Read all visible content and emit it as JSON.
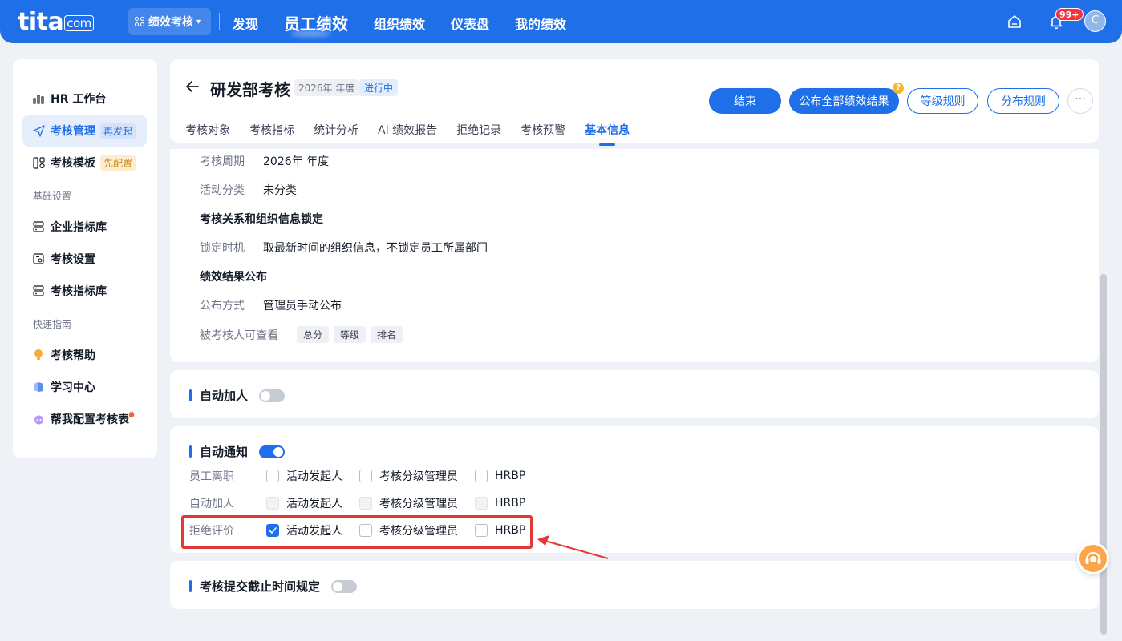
{
  "topbar": {
    "logo": "tita",
    "logo_suffix": "com",
    "module_switch": "绩效考核",
    "nav": [
      "发现",
      "员工绩效",
      "组织绩效",
      "仪表盘",
      "我的绩效"
    ],
    "notification_count": "99+",
    "avatar_initial": "C"
  },
  "sidebar": {
    "hr_workbench": "HR 工作台",
    "assessment_mgmt": "考核管理",
    "assessment_mgmt_tag": "再发起",
    "assessment_template": "考核模板",
    "assessment_template_tag": "先配置",
    "group_basic": "基础设置",
    "enterprise_indicators": "企业指标库",
    "assessment_settings": "考核设置",
    "assessment_indicators": "考核指标库",
    "group_guide": "快速指南",
    "assessment_help": "考核帮助",
    "learning_center": "学习中心",
    "config_helper": "帮我配置考核表"
  },
  "header": {
    "title": "研发部考核",
    "period_tag": "2026年 年度",
    "status_tag": "进行中",
    "btn_end": "结束",
    "btn_publish": "公布全部绩效结果",
    "btn_publish_hint": "?",
    "btn_grade_rules": "等级规则",
    "btn_dist_rules": "分布规则",
    "btn_more": "···",
    "tabs": [
      "考核对象",
      "考核指标",
      "统计分析",
      "AI 绩效报告",
      "拒绝记录",
      "考核预警",
      "基本信息"
    ],
    "active_tab": "基本信息"
  },
  "info": {
    "period_label": "考核周期",
    "period_value": "2026年 年度",
    "category_label": "活动分类",
    "category_value": "未分类",
    "lock_heading": "考核关系和组织信息锁定",
    "lock_time_label": "锁定时机",
    "lock_time_value": "取最新时间的组织信息，不锁定员工所属部门",
    "publish_heading": "绩效结果公布",
    "publish_mode_label": "公布方式",
    "publish_mode_value": "管理员手动公布",
    "viewable_label": "被考核人可查看",
    "viewable_chips": [
      "总分",
      "等级",
      "排名"
    ]
  },
  "auto_add": {
    "title": "自动加人",
    "enabled": false
  },
  "auto_notify": {
    "title": "自动通知",
    "enabled": true,
    "options": [
      "活动发起人",
      "考核分级管理员",
      "HRBP"
    ],
    "rows": [
      {
        "label": "员工离职",
        "checked": [
          false,
          false,
          false
        ],
        "disabled": false
      },
      {
        "label": "自动加人",
        "checked": [
          false,
          false,
          false
        ],
        "disabled": true
      },
      {
        "label": "拒绝评价",
        "checked": [
          true,
          false,
          false
        ],
        "disabled": false
      }
    ]
  },
  "deadline": {
    "title": "考核提交截止时间规定",
    "enabled": false
  },
  "colors": {
    "primary": "#1f6fe9",
    "highlight": "#e53935",
    "help_button": "#fda54a"
  }
}
